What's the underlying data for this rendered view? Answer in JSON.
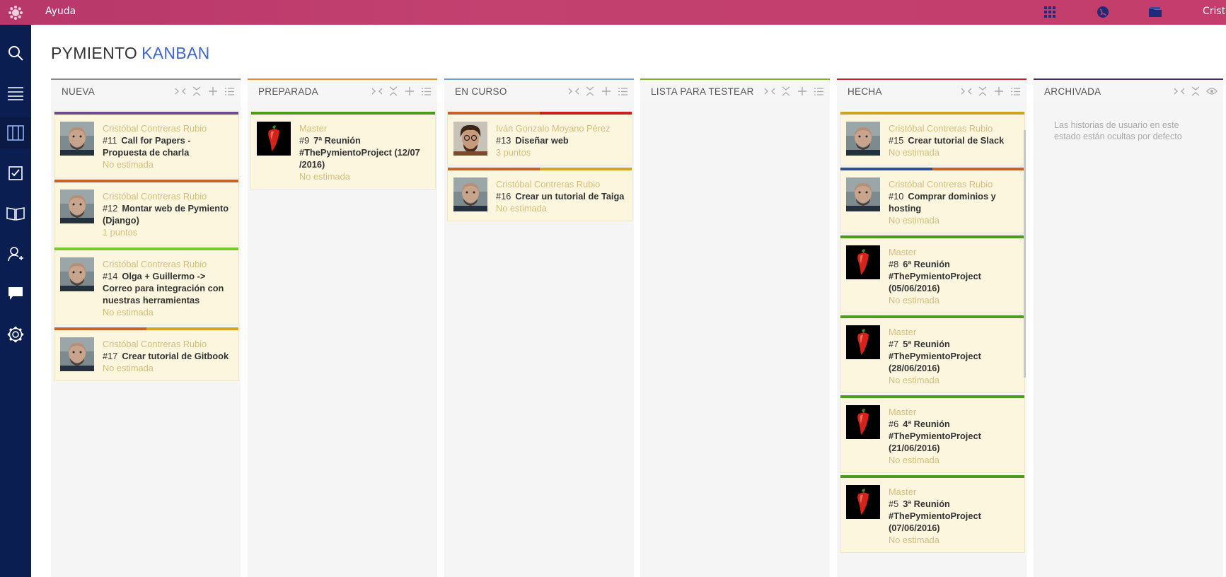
{
  "topbar": {
    "help_label": "Ayuda",
    "user_label": "Cristóbal",
    "icons": [
      "logo-icon",
      "apps-grid-icon",
      "globe-icon",
      "folder-icon"
    ]
  },
  "sidebar": {
    "items": [
      {
        "name": "search-icon",
        "active": false
      },
      {
        "name": "backlog-icon",
        "active": false
      },
      {
        "name": "kanban-icon",
        "active": true
      },
      {
        "name": "issues-icon",
        "active": false
      },
      {
        "name": "wiki-icon",
        "active": false
      },
      {
        "name": "team-icon",
        "active": false
      },
      {
        "name": "chat-icon",
        "active": false
      },
      {
        "name": "settings-icon",
        "active": false
      }
    ]
  },
  "page": {
    "project": "PYMIENTO",
    "section": "KANBAN"
  },
  "colors": {
    "topbar": "#c2416f",
    "sidebar": "#0b1e52",
    "accent": "#3f66c8",
    "card_bg": "#fdf6df",
    "muted_text": "#d4bd7c"
  },
  "columns": [
    {
      "title": "NUEVA",
      "color": "#8a8a8a",
      "icons": [
        "fold",
        "collapse",
        "add",
        "bulk"
      ],
      "cards": [
        {
          "avatar": "person",
          "stripe": [
            "#6e4a8a"
          ],
          "assigned": "Cristóbal Contreras Rubio",
          "ref": "#11",
          "subject": "Call for Papers - Propuesta de charla",
          "points": "No estimada"
        },
        {
          "avatar": "person",
          "stripe": [
            "#c8612a"
          ],
          "assigned": "Cristóbal Contreras Rubio",
          "ref": "#12",
          "subject": "Montar web de Pymiento (Django)",
          "points": "1 puntos"
        },
        {
          "avatar": "person",
          "stripe": [
            "#7bc42a"
          ],
          "assigned": "Cristóbal Contreras Rubio",
          "ref": "#14",
          "subject": "Olga + Guillermo -> Correo para integración con nuestras herramientas",
          "points": "No estimada"
        },
        {
          "avatar": "person",
          "stripe": [
            "#c8612a",
            "#d4a520"
          ],
          "assigned": "Cristóbal Contreras Rubio",
          "ref": "#17",
          "subject": "Crear tutorial de Gitbook",
          "points": "No estimada"
        }
      ]
    },
    {
      "title": "PREPARADA",
      "color": "#e88c2e",
      "icons": [
        "fold",
        "collapse",
        "add",
        "bulk"
      ],
      "cards": [
        {
          "avatar": "pepper",
          "stripe": [
            "#4c9a1e"
          ],
          "assigned": "Master",
          "ref": "#9",
          "subject": "7ª Reunión #ThePymientoProject (12/07 /2016)",
          "points": "No estimada"
        }
      ]
    },
    {
      "title": "EN CURSO",
      "color": "#6f9fd8",
      "icons": [
        "fold",
        "collapse",
        "add",
        "bulk"
      ],
      "cards": [
        {
          "avatar": "person2",
          "stripe": [
            "#c8612a",
            "#c91f1f"
          ],
          "assigned": "Iván Gonzalo Moyano Pérez",
          "ref": "#13",
          "subject": "Diseñar web",
          "points": "3 puntos"
        },
        {
          "avatar": "person",
          "stripe": [
            "#c8612a",
            "#d4a520"
          ],
          "assigned": "Cristóbal Contreras Rubio",
          "ref": "#16",
          "subject": "Crear un tutorial de Taiga",
          "points": "No estimada"
        }
      ]
    },
    {
      "title": "LISTA PARA TESTEAR",
      "color": "#7bb22a",
      "icons": [
        "fold",
        "collapse",
        "add",
        "bulk"
      ],
      "cards": []
    },
    {
      "title": "HECHA",
      "color": "#c91f2a",
      "icons": [
        "fold",
        "collapse",
        "add",
        "bulk"
      ],
      "cards": [
        {
          "avatar": "person",
          "stripe": [
            "#c9a520"
          ],
          "assigned": "Cristóbal Contreras Rubio",
          "ref": "#15",
          "subject": "Crear tutorial de Slack",
          "points": "No estimada"
        },
        {
          "avatar": "person",
          "stripe": [
            "#2f4f8a",
            "#c8612a"
          ],
          "assigned": "Cristóbal Contreras Rubio",
          "ref": "#10",
          "subject": "Comprar dominios y hosting",
          "points": "No estimada"
        },
        {
          "avatar": "pepper",
          "stripe": [
            "#4c9a1e"
          ],
          "assigned": "Master",
          "ref": "#8",
          "subject": "6ª Reunión #ThePymientoProject (05/06/2016)",
          "points": "No estimada"
        },
        {
          "avatar": "pepper",
          "stripe": [
            "#4c9a1e"
          ],
          "assigned": "Master",
          "ref": "#7",
          "subject": "5ª Reunión #ThePymientoProject (28/06/2016)",
          "points": "No estimada"
        },
        {
          "avatar": "pepper",
          "stripe": [
            "#4c9a1e"
          ],
          "assigned": "Master",
          "ref": "#6",
          "subject": "4ª Reunión #ThePymientoProject (21/06/2016)",
          "points": "No estimada"
        },
        {
          "avatar": "pepper",
          "stripe": [
            "#4c9a1e"
          ],
          "assigned": "Master",
          "ref": "#5",
          "subject": "3ª Reunión #ThePymientoProject (07/06/2016)",
          "points": "No estimada"
        }
      ]
    },
    {
      "title": "ARCHIVADA",
      "color": "#4a2a6a",
      "icons": [
        "fold",
        "collapse",
        "eye"
      ],
      "note": "Las historias de usuario en este estado están ocultas por defecto",
      "cards": []
    }
  ]
}
